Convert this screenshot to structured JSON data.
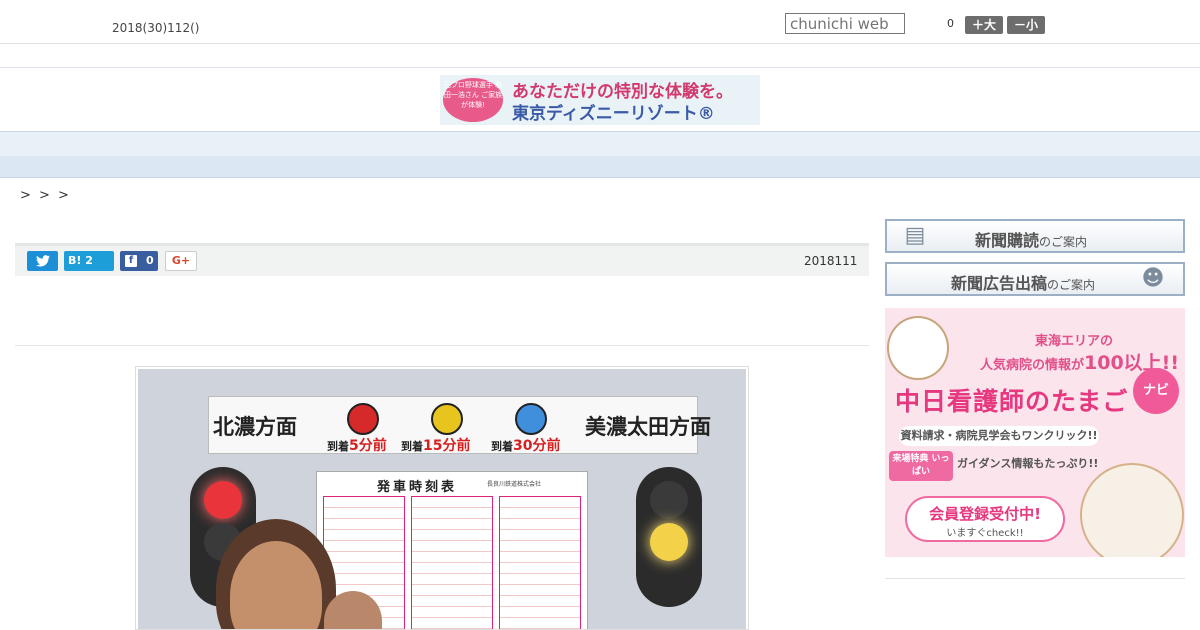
{
  "header": {
    "date": "2018(30)112()",
    "search_placeholder": "chunichi web",
    "font_size_count": "0",
    "font_bigger_label": "＋大",
    "font_smaller_label": "－小"
  },
  "banner": {
    "badge_text": "元プロ野球選手 和田一浩さん ご家族が体験!",
    "line1": "あなただけの特別な体験を。",
    "line2": "東京ディズニーリゾート®"
  },
  "nav": {
    "items": [
      "",
      "",
      "",
      "",
      "",
      "",
      "",
      "",
      ""
    ]
  },
  "breadcrumb": "> > >",
  "share": {
    "hatena_label": "B!",
    "hatena_count": "2",
    "facebook_count": "0",
    "gplus_label": "G+",
    "publish_date": "2018111"
  },
  "photo": {
    "left_direction": "北濃方面",
    "right_direction": "美濃太田方面",
    "arrivals": [
      {
        "prefix": "到着",
        "value": "5分前"
      },
      {
        "prefix": "到着",
        "value": "15分前"
      },
      {
        "prefix": "到着",
        "value": "30分前"
      }
    ],
    "timetable_title": "発車時刻表",
    "timetable_company": "長良川鉄道株式会社",
    "lamp_colors": [
      "#d62a2a",
      "#e8c51e",
      "#3f8fdc"
    ]
  },
  "sidebar": {
    "subscribe": {
      "main": "新聞購読",
      "sub": "のご案内"
    },
    "advertise": {
      "main": "新聞広告出稿",
      "sub": "のご案内"
    },
    "nurse_ad": {
      "line1": "東海エリアの",
      "line2_pre": "人気病院の情報が",
      "line2_num": "100以上!!",
      "title": "中日看護師のたまご",
      "navi": "ナビ",
      "cta1": "資料請求・病院見学会もワンクリック!!",
      "special": "来場特典 いっぱい",
      "cta2": "ガイダンス情報もたっぷり!!",
      "signup": "会員登録受付中!",
      "check": "いますぐcheck!!"
    }
  }
}
